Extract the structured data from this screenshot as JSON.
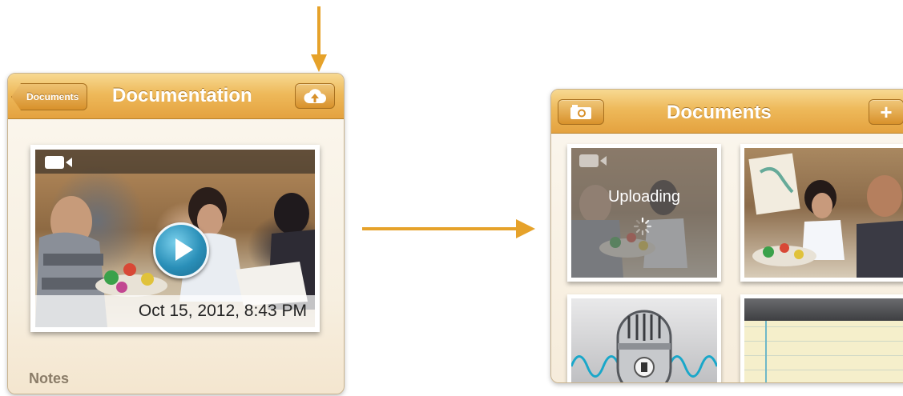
{
  "left_screen": {
    "back_button": "Documents",
    "title": "Documentation",
    "upload_icon": "cloud-upload-icon",
    "video": {
      "type_icon": "video-camera-icon",
      "play_icon": "play-icon",
      "timestamp": "Oct 15, 2012, 8:43 PM"
    },
    "notes_label": "Notes"
  },
  "right_screen": {
    "camera_icon": "camera-icon",
    "title": "Documents",
    "add_icon": "plus-icon",
    "add_label": "+",
    "items": [
      {
        "kind": "video",
        "icon": "video-camera-icon",
        "status": "Uploading"
      },
      {
        "kind": "photo"
      },
      {
        "kind": "audio",
        "icon": "microphone-icon"
      },
      {
        "kind": "note"
      }
    ]
  },
  "colors": {
    "navbar": "#eeb95a",
    "arrow": "#e6a22a",
    "play": "#2a8fb8"
  }
}
